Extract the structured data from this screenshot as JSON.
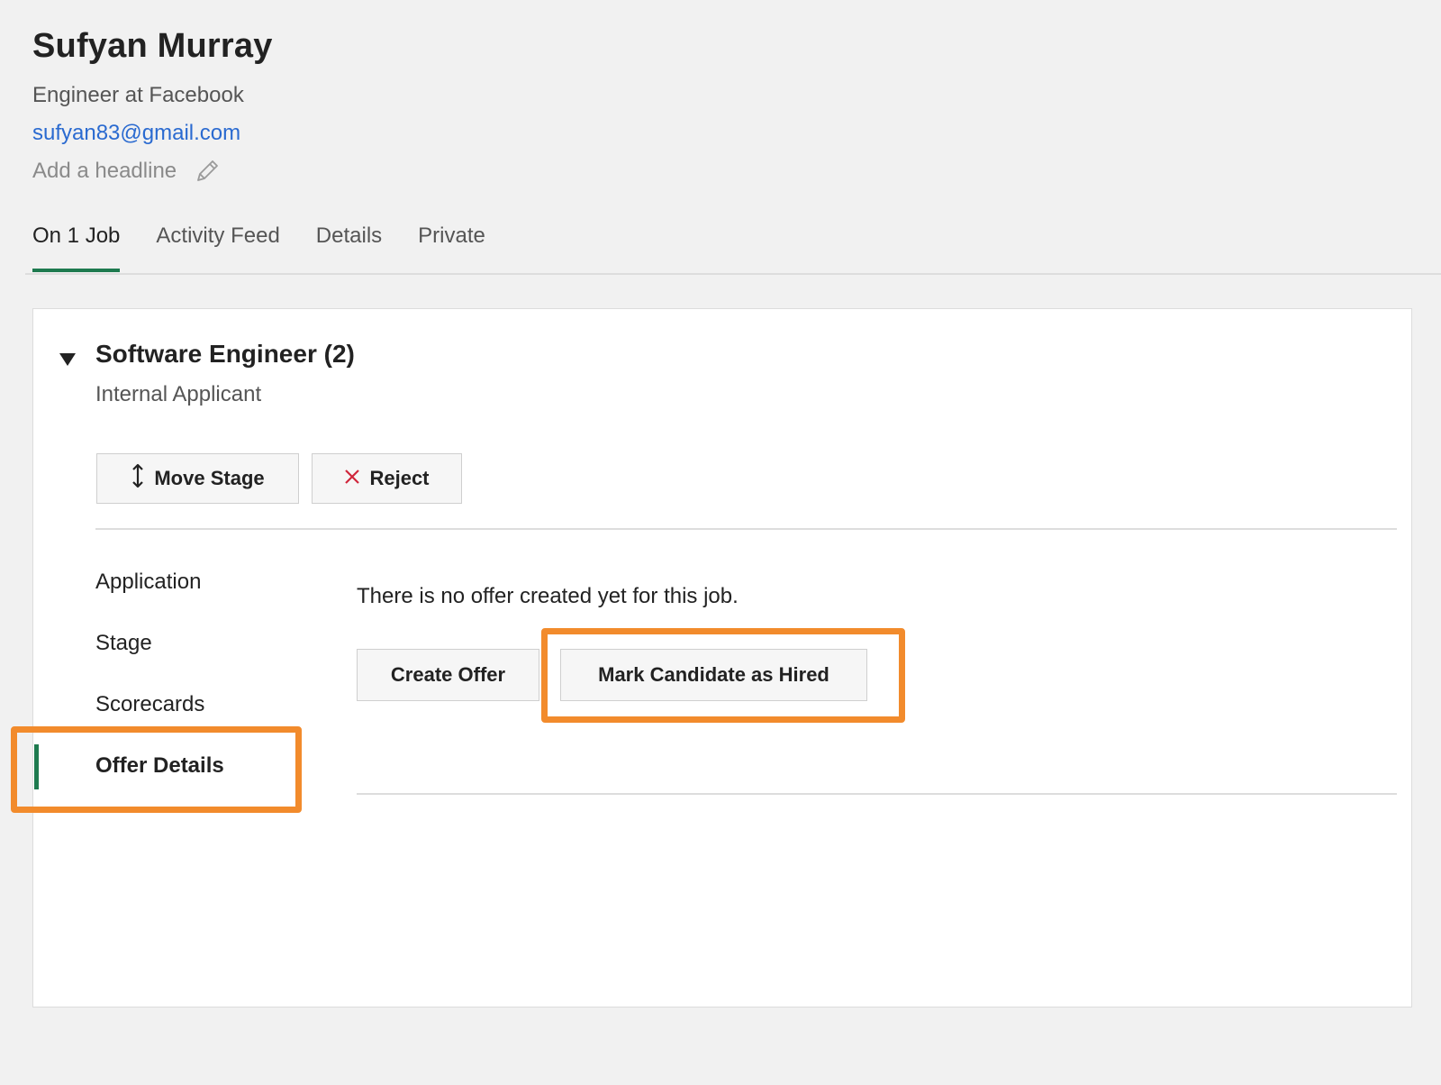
{
  "header": {
    "name": "Sufyan Murray",
    "title": "Engineer at Facebook",
    "email": "sufyan83@gmail.com",
    "headline_placeholder": "Add a headline",
    "edit_icon": "pencil-icon"
  },
  "tabs": [
    {
      "label": "On 1 Job",
      "active": true
    },
    {
      "label": "Activity Feed",
      "active": false
    },
    {
      "label": "Details",
      "active": false
    },
    {
      "label": "Private",
      "active": false
    }
  ],
  "job": {
    "title": "Software Engineer (2)",
    "subtitle": "Internal Applicant",
    "toggle_icon": "caret-down-icon",
    "actions": {
      "move_stage_label": "Move Stage",
      "move_stage_icon": "vertical-arrows-icon",
      "reject_label": "Reject",
      "reject_icon": "x-icon"
    }
  },
  "side_nav": {
    "items": [
      {
        "label": "Application",
        "active": false
      },
      {
        "label": "Stage",
        "active": false
      },
      {
        "label": "Scorecards",
        "active": false
      },
      {
        "label": "Offer Details",
        "active": true
      }
    ]
  },
  "offer": {
    "message": "There is no offer created yet for this job.",
    "create_offer_label": "Create Offer",
    "mark_hired_label": "Mark Candidate as Hired"
  },
  "colors": {
    "accent_green": "#1e7a4f",
    "link_blue": "#2a6ad0",
    "highlight_orange": "#f28b2c",
    "reject_red": "#d0263b",
    "page_background": "#f1f1f1"
  }
}
